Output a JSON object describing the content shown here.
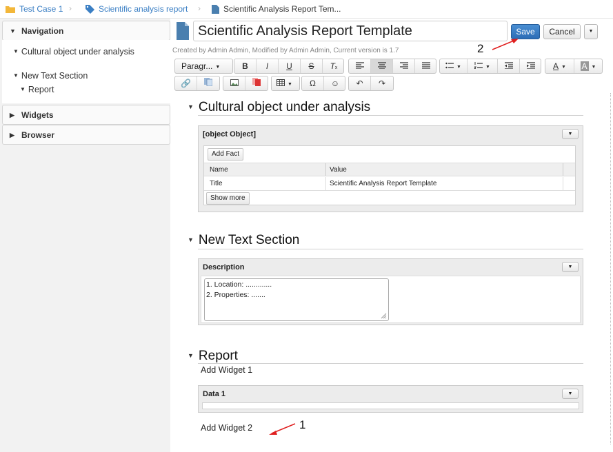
{
  "breadcrumb": {
    "items": [
      {
        "label": "Test Case 1",
        "icon": "folder-icon"
      },
      {
        "label": "Scientific analysis report",
        "icon": "tag-icon"
      },
      {
        "label": "Scientific Analysis Report Tem...",
        "icon": "document-icon"
      }
    ]
  },
  "sidebar": {
    "navigation": {
      "label": "Navigation",
      "items": [
        "Cultural object under analysis",
        "New Text Section",
        "Report"
      ]
    },
    "widgets_label": "Widgets",
    "browser_label": "Browser"
  },
  "header": {
    "title": "Scientific Analysis Report Template",
    "save_label": "Save",
    "cancel_label": "Cancel",
    "meta": "Created by Admin Admin, Modified by Admin Admin, Current version is 1.7"
  },
  "toolbar": {
    "format_label": "Paragr..."
  },
  "annotations": {
    "two": "2",
    "one": "1"
  },
  "sections": [
    {
      "title": "Cultural object under analysis",
      "widget": {
        "title": "[object Object]",
        "add_fact_label": "Add Fact",
        "columns": [
          "Name",
          "Value"
        ],
        "rows": [
          [
            "Title",
            "Scientific Analysis Report Template"
          ]
        ],
        "show_more_label": "Show more"
      }
    },
    {
      "title": "New Text Section",
      "widget": {
        "title": "Description",
        "lines": [
          "1. Location: .............",
          "2. Properties: ......."
        ]
      }
    },
    {
      "title": "Report",
      "add_widget_1": "Add Widget 1",
      "widget": {
        "title": "Data 1"
      },
      "add_widget_2": "Add Widget 2"
    }
  ],
  "colors": {
    "link": "#3b7fc4",
    "primary": "#2c6db6",
    "annotation_arrow": "#e02020"
  }
}
